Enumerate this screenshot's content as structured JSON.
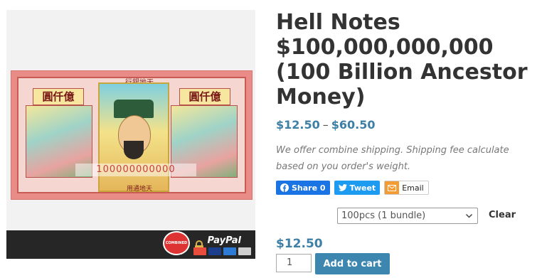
{
  "product": {
    "title": "Hell Notes $100,000,000,000 (100 Billion Ancestor Money)",
    "price_min": "$12.50",
    "price_sep": "–",
    "price_max": "$60.50",
    "description": "We offer combine shipping. Shipping fee calculate based on you order's weight."
  },
  "image": {
    "top_text": "行銀地天",
    "cap_left": "圓仟億",
    "cap_right": "圓仟億",
    "number": "100000000000",
    "bottom_text": "用通地天",
    "badge_text": "COMBINED SHIPPING",
    "paypal_text": "PayPal",
    "card_colors": [
      "#e74c3c",
      "#1a3e8c",
      "#2e7bd6",
      "#cfcfcf"
    ]
  },
  "share": {
    "facebook_label": "Share 0",
    "twitter_label": "Tweet",
    "email_label": "Email"
  },
  "variation": {
    "selected": "100pcs (1 bundle)",
    "clear_label": "Clear",
    "price": "$12.50"
  },
  "cart": {
    "quantity": "1",
    "add_label": "Add to cart"
  },
  "colors": {
    "accent": "#3d7fa6",
    "button": "#3c86b0",
    "facebook": "#1b74e4",
    "twitter": "#1d9bf0",
    "email": "#f39c34"
  }
}
